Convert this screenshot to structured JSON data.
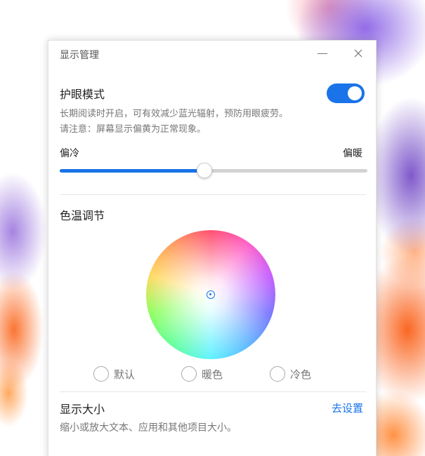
{
  "window": {
    "title": "显示管理"
  },
  "eye_care": {
    "title": "护眼模式",
    "enabled": true,
    "description_line1": "长期阅读时开启，可有效减少蓝光辐射，预防用眼疲劳。",
    "description_line2": "请注意：屏幕显示偏黄为正常现象。",
    "slider": {
      "label_left": "偏冷",
      "label_right": "偏暖",
      "value_fraction": 0.47
    }
  },
  "color_temperature": {
    "title": "色温调节",
    "options": [
      {
        "label": "默认",
        "selected": false
      },
      {
        "label": "暖色",
        "selected": false
      },
      {
        "label": "冷色",
        "selected": false
      }
    ]
  },
  "display_size": {
    "title": "显示大小",
    "link_label": "去设置",
    "description": "缩小或放大文本、应用和其他项目大小。"
  },
  "colors": {
    "accent": "#1a73e8"
  }
}
